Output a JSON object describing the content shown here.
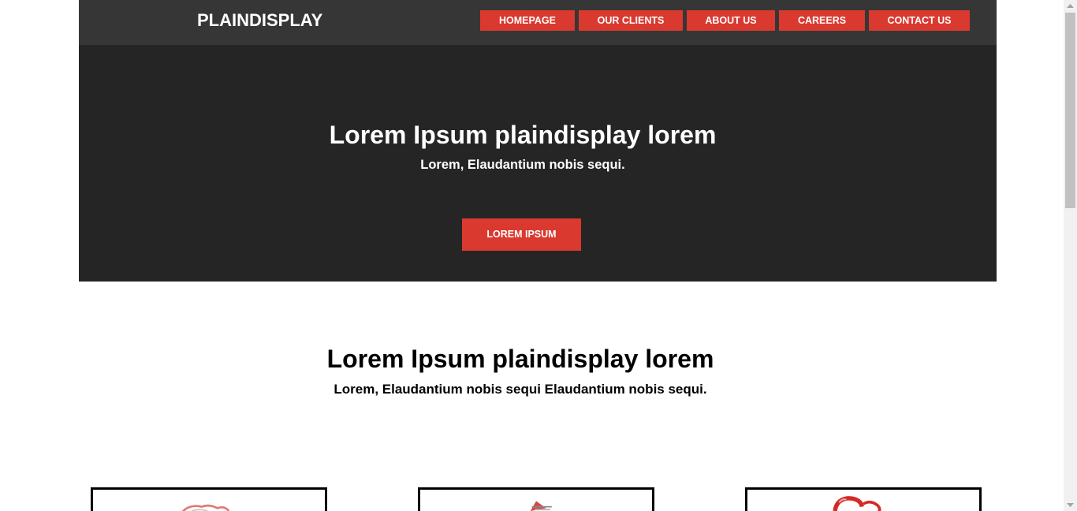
{
  "header": {
    "logo": "PLAINDISPLAY",
    "nav": [
      {
        "label": "HOMEPAGE"
      },
      {
        "label": "OUR CLIENTS"
      },
      {
        "label": "ABOUT US"
      },
      {
        "label": "CAREERS"
      },
      {
        "label": "CONTACT US"
      }
    ]
  },
  "hero": {
    "title": "Lorem Ipsum plaindisplay lorem",
    "subtitle": "Lorem, Elaudantium nobis sequi.",
    "cta_label": "LOREM IPSUM"
  },
  "section": {
    "title": "Lorem Ipsum plaindisplay lorem",
    "subtitle": "Lorem, Elaudantium nobis sequi Elaudantium nobis sequi."
  },
  "cards": [
    {
      "icon": "product-image-icon"
    },
    {
      "icon": "product-image-icon"
    },
    {
      "icon": "product-image-icon"
    }
  ],
  "colors": {
    "header_bg": "#363636",
    "hero_bg": "#252525",
    "accent": "#d9392f"
  }
}
